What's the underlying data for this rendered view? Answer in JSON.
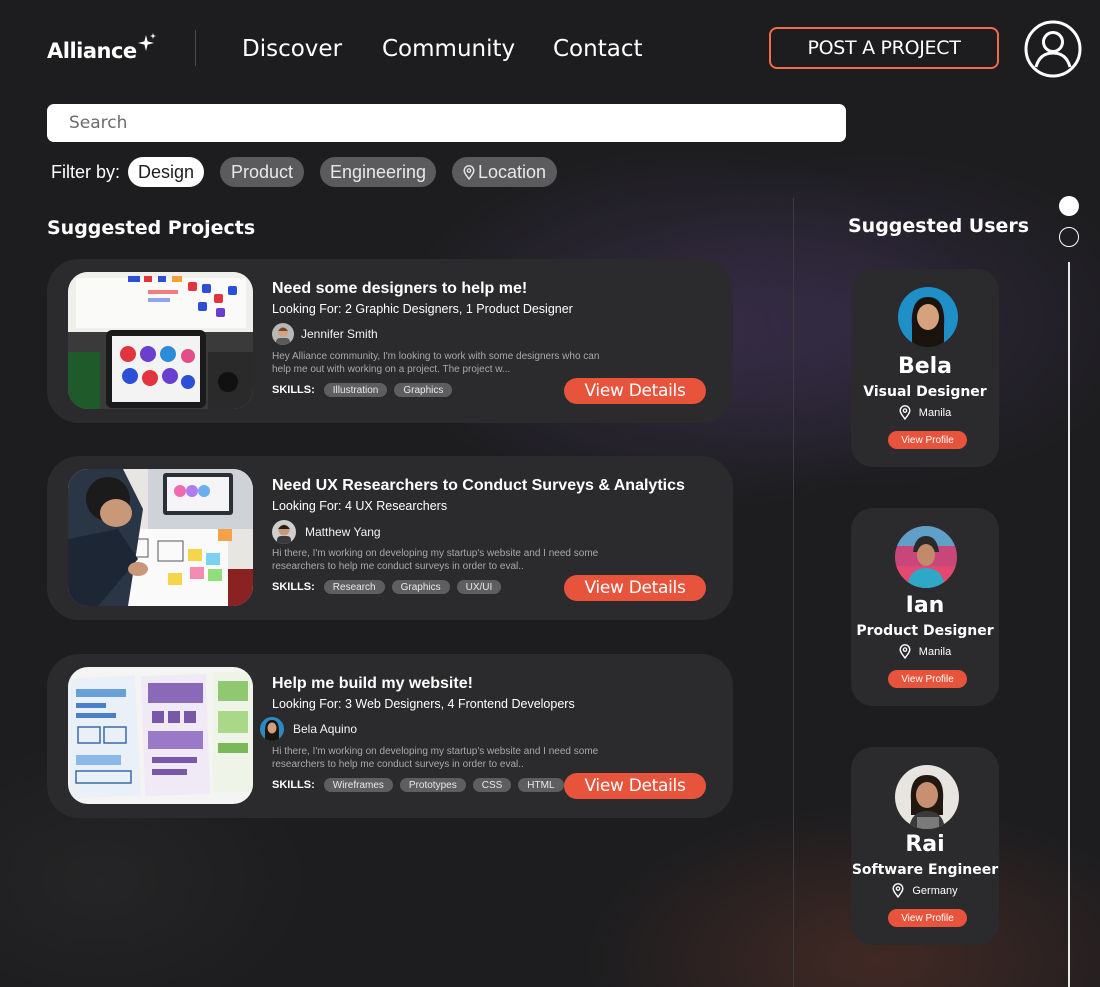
{
  "header": {
    "logo": "Alliance",
    "nav": [
      "Discover",
      "Community",
      "Contact"
    ],
    "post_button": "POST A PROJECT"
  },
  "search": {
    "placeholder": "Search"
  },
  "filters": {
    "label": "Filter by:",
    "chips": [
      {
        "label": "Design",
        "active": true
      },
      {
        "label": "Product",
        "active": false
      },
      {
        "label": "Engineering",
        "active": false
      },
      {
        "label": "Location",
        "active": false,
        "icon": "location-pin-icon"
      }
    ]
  },
  "projects_section": {
    "title": "Suggested Projects",
    "skills_label": "SKILLS:",
    "view_button": "View Details",
    "items": [
      {
        "title": "Need some designers to help me!",
        "looking_for": "Looking For: 2 Graphic Designers, 1 Product Designer",
        "author": "Jennifer Smith",
        "description": "Hey Alliance community, I'm looking to work with some designers who can help me out with working on a project. The project w...",
        "skills": [
          "Illustration",
          "Graphics"
        ]
      },
      {
        "title": "Need UX Researchers to Conduct Surveys & Analytics",
        "looking_for": "Looking For: 4 UX Researchers",
        "author": "Matthew Yang",
        "description": "Hi there, I'm working on developing my startup's website and I need some researchers to help me conduct surveys in order to eval..",
        "skills": [
          "Research",
          "Graphics",
          "UX/UI"
        ]
      },
      {
        "title": "Help me build my website!",
        "looking_for": "Looking For: 3 Web Designers, 4 Frontend Developers",
        "author": "Bela Aquino",
        "description": "Hi there, I'm working on developing my startup's website and I need some researchers to help me conduct surveys in order to eval..",
        "skills": [
          "Wireframes",
          "Prototypes",
          "CSS",
          "HTML"
        ]
      }
    ]
  },
  "users_section": {
    "title": "Suggested Users",
    "profile_button": "View Profile",
    "items": [
      {
        "name": "Bela",
        "role": "Visual Designer",
        "location": "Manila"
      },
      {
        "name": "Ian",
        "role": "Product Designer",
        "location": "Manila"
      },
      {
        "name": "Rai",
        "role": "Software Engineer",
        "location": "Germany"
      }
    ]
  },
  "colors": {
    "accent": "#e8533c",
    "outline": "#f06c4a",
    "card": "#2b2b2d",
    "background": "#1d1d1f"
  }
}
